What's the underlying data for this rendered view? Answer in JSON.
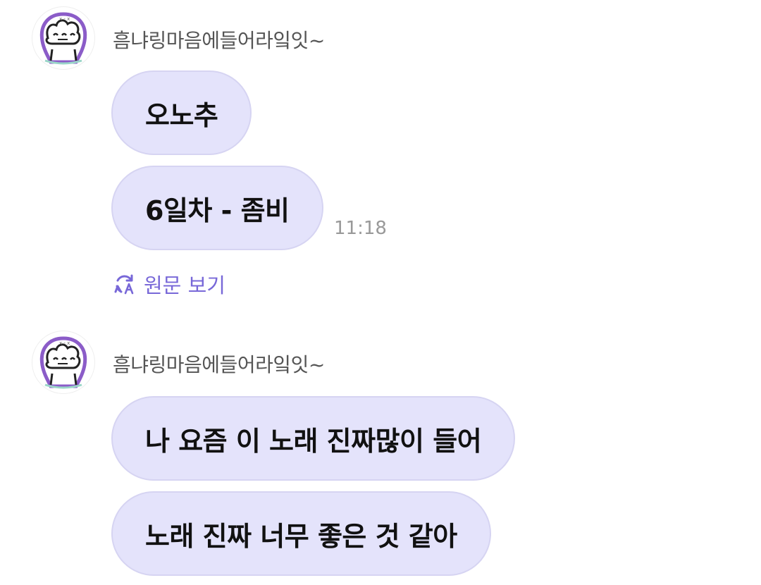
{
  "messages": [
    {
      "sender": "흠냐링마음에들어라잌잇~",
      "bubbles": [
        "오노추",
        "6일차 - 좀비"
      ],
      "time": "11:18",
      "translate_label": "원문 보기"
    },
    {
      "sender": "흠냐링마음에들어라잌잇~",
      "bubbles": [
        "나 요즘 이 노래 진짜많이 들어",
        "노래 진짜 너무 좋은 것 같아"
      ]
    }
  ],
  "icons": {
    "avatar": "cartoon-character-avatar-icon",
    "translate": "translate-refresh-icon"
  },
  "colors": {
    "bubble_background": "#e4e3fb",
    "bubble_border": "#d6d4f2",
    "link_accent": "#7868d8",
    "timestamp": "#999999"
  }
}
